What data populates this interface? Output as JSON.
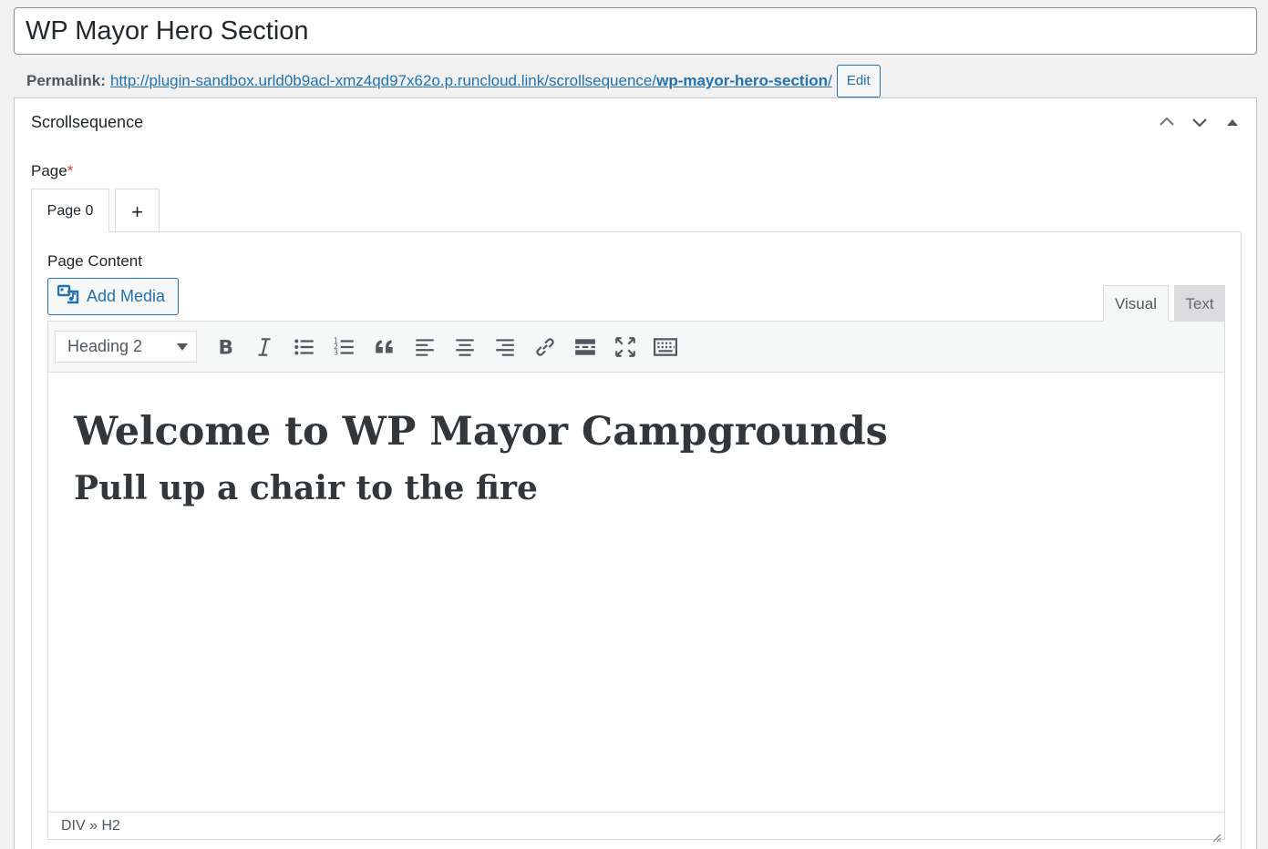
{
  "post": {
    "title": "WP Mayor Hero Section",
    "permalink_label": "Permalink:",
    "permalink_base": "http://plugin-sandbox.urld0b9acl-xmz4qd97x62o.p.runcloud.link/scrollsequence/",
    "permalink_slug": "wp-mayor-hero-section",
    "permalink_trailing": "/",
    "edit_label": "Edit"
  },
  "metabox": {
    "title": "Scrollsequence",
    "page_label": "Page",
    "required_mark": "*",
    "tabs": [
      {
        "label": "Page 0",
        "active": true
      },
      {
        "label": "+",
        "active": false
      }
    ]
  },
  "editor": {
    "content_label": "Page Content",
    "add_media_label": "Add Media",
    "mode_visual": "Visual",
    "mode_text": "Text",
    "format_selected": "Heading 2",
    "toolbar_icons": [
      "bold-icon",
      "italic-icon",
      "bulleted-list-icon",
      "numbered-list-icon",
      "blockquote-icon",
      "align-left-icon",
      "align-center-icon",
      "align-right-icon",
      "link-icon",
      "read-more-icon",
      "fullscreen-icon",
      "toolbar-toggle-icon"
    ],
    "heading1": "Welcome to WP Mayor Campgrounds",
    "heading2": "Pull up a chair to the fire",
    "path": "DIV » H2"
  },
  "colors": {
    "accent": "#2271b1",
    "text": "#23282d",
    "required": "#d63638"
  }
}
